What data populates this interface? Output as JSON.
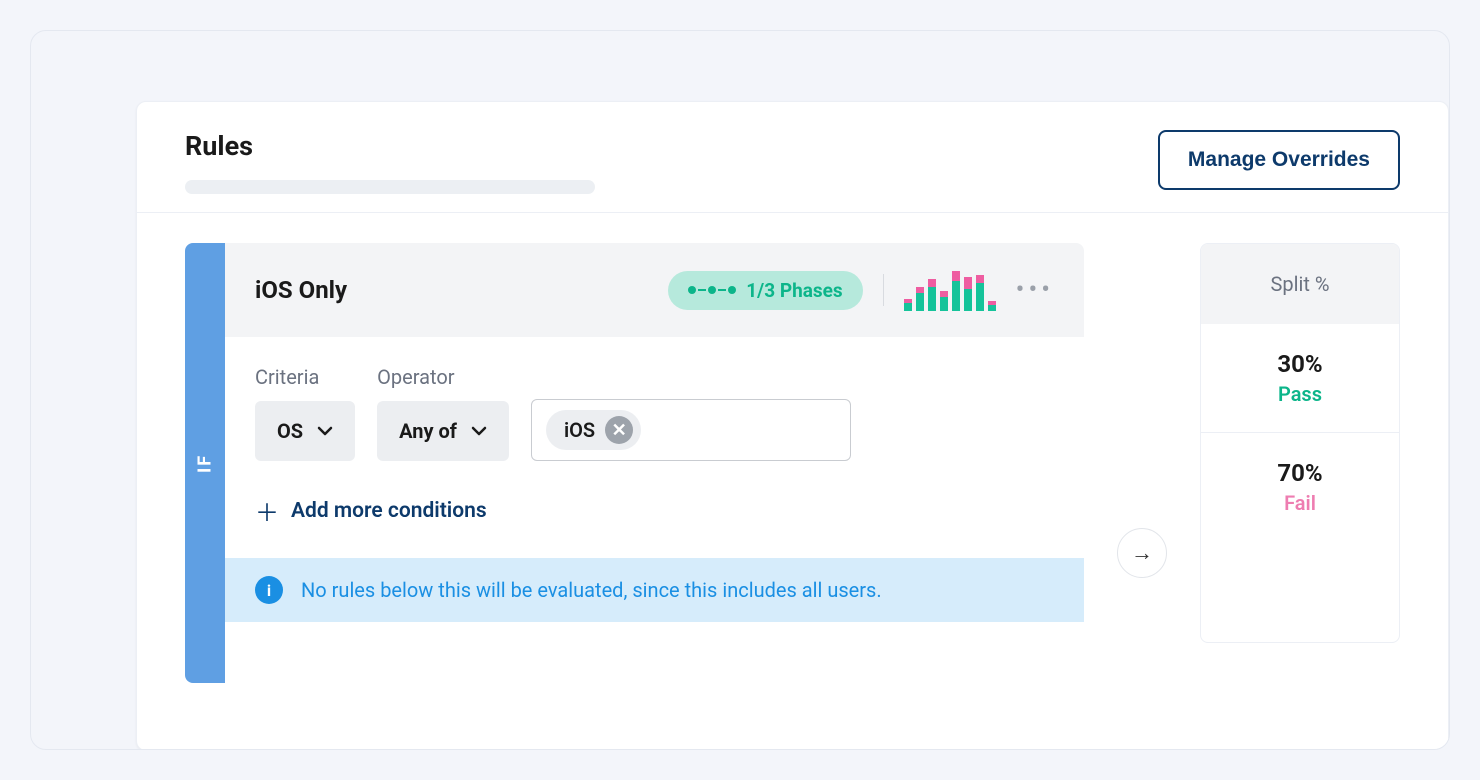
{
  "header": {
    "title": "Rules",
    "manage_button": "Manage Overrides"
  },
  "rule": {
    "rail_label": "IF",
    "name": "iOS Only",
    "phases_label": "1/3 Phases",
    "fields": {
      "criteria_label": "Criteria",
      "criteria_value": "OS",
      "operator_label": "Operator",
      "operator_value": "Any of",
      "chip_value": "iOS"
    },
    "add_conditions": "Add more conditions",
    "info_message": "No rules below this will be evaluated, since this includes all users."
  },
  "split": {
    "header": "Split %",
    "pass_pct": "30%",
    "pass_label": "Pass",
    "fail_pct": "70%",
    "fail_label": "Fail"
  },
  "spark_bars": [
    {
      "g": 8,
      "p": 4
    },
    {
      "g": 18,
      "p": 6
    },
    {
      "g": 24,
      "p": 8
    },
    {
      "g": 14,
      "p": 6
    },
    {
      "g": 30,
      "p": 10
    },
    {
      "g": 22,
      "p": 12
    },
    {
      "g": 28,
      "p": 8
    },
    {
      "g": 6,
      "p": 4
    }
  ]
}
